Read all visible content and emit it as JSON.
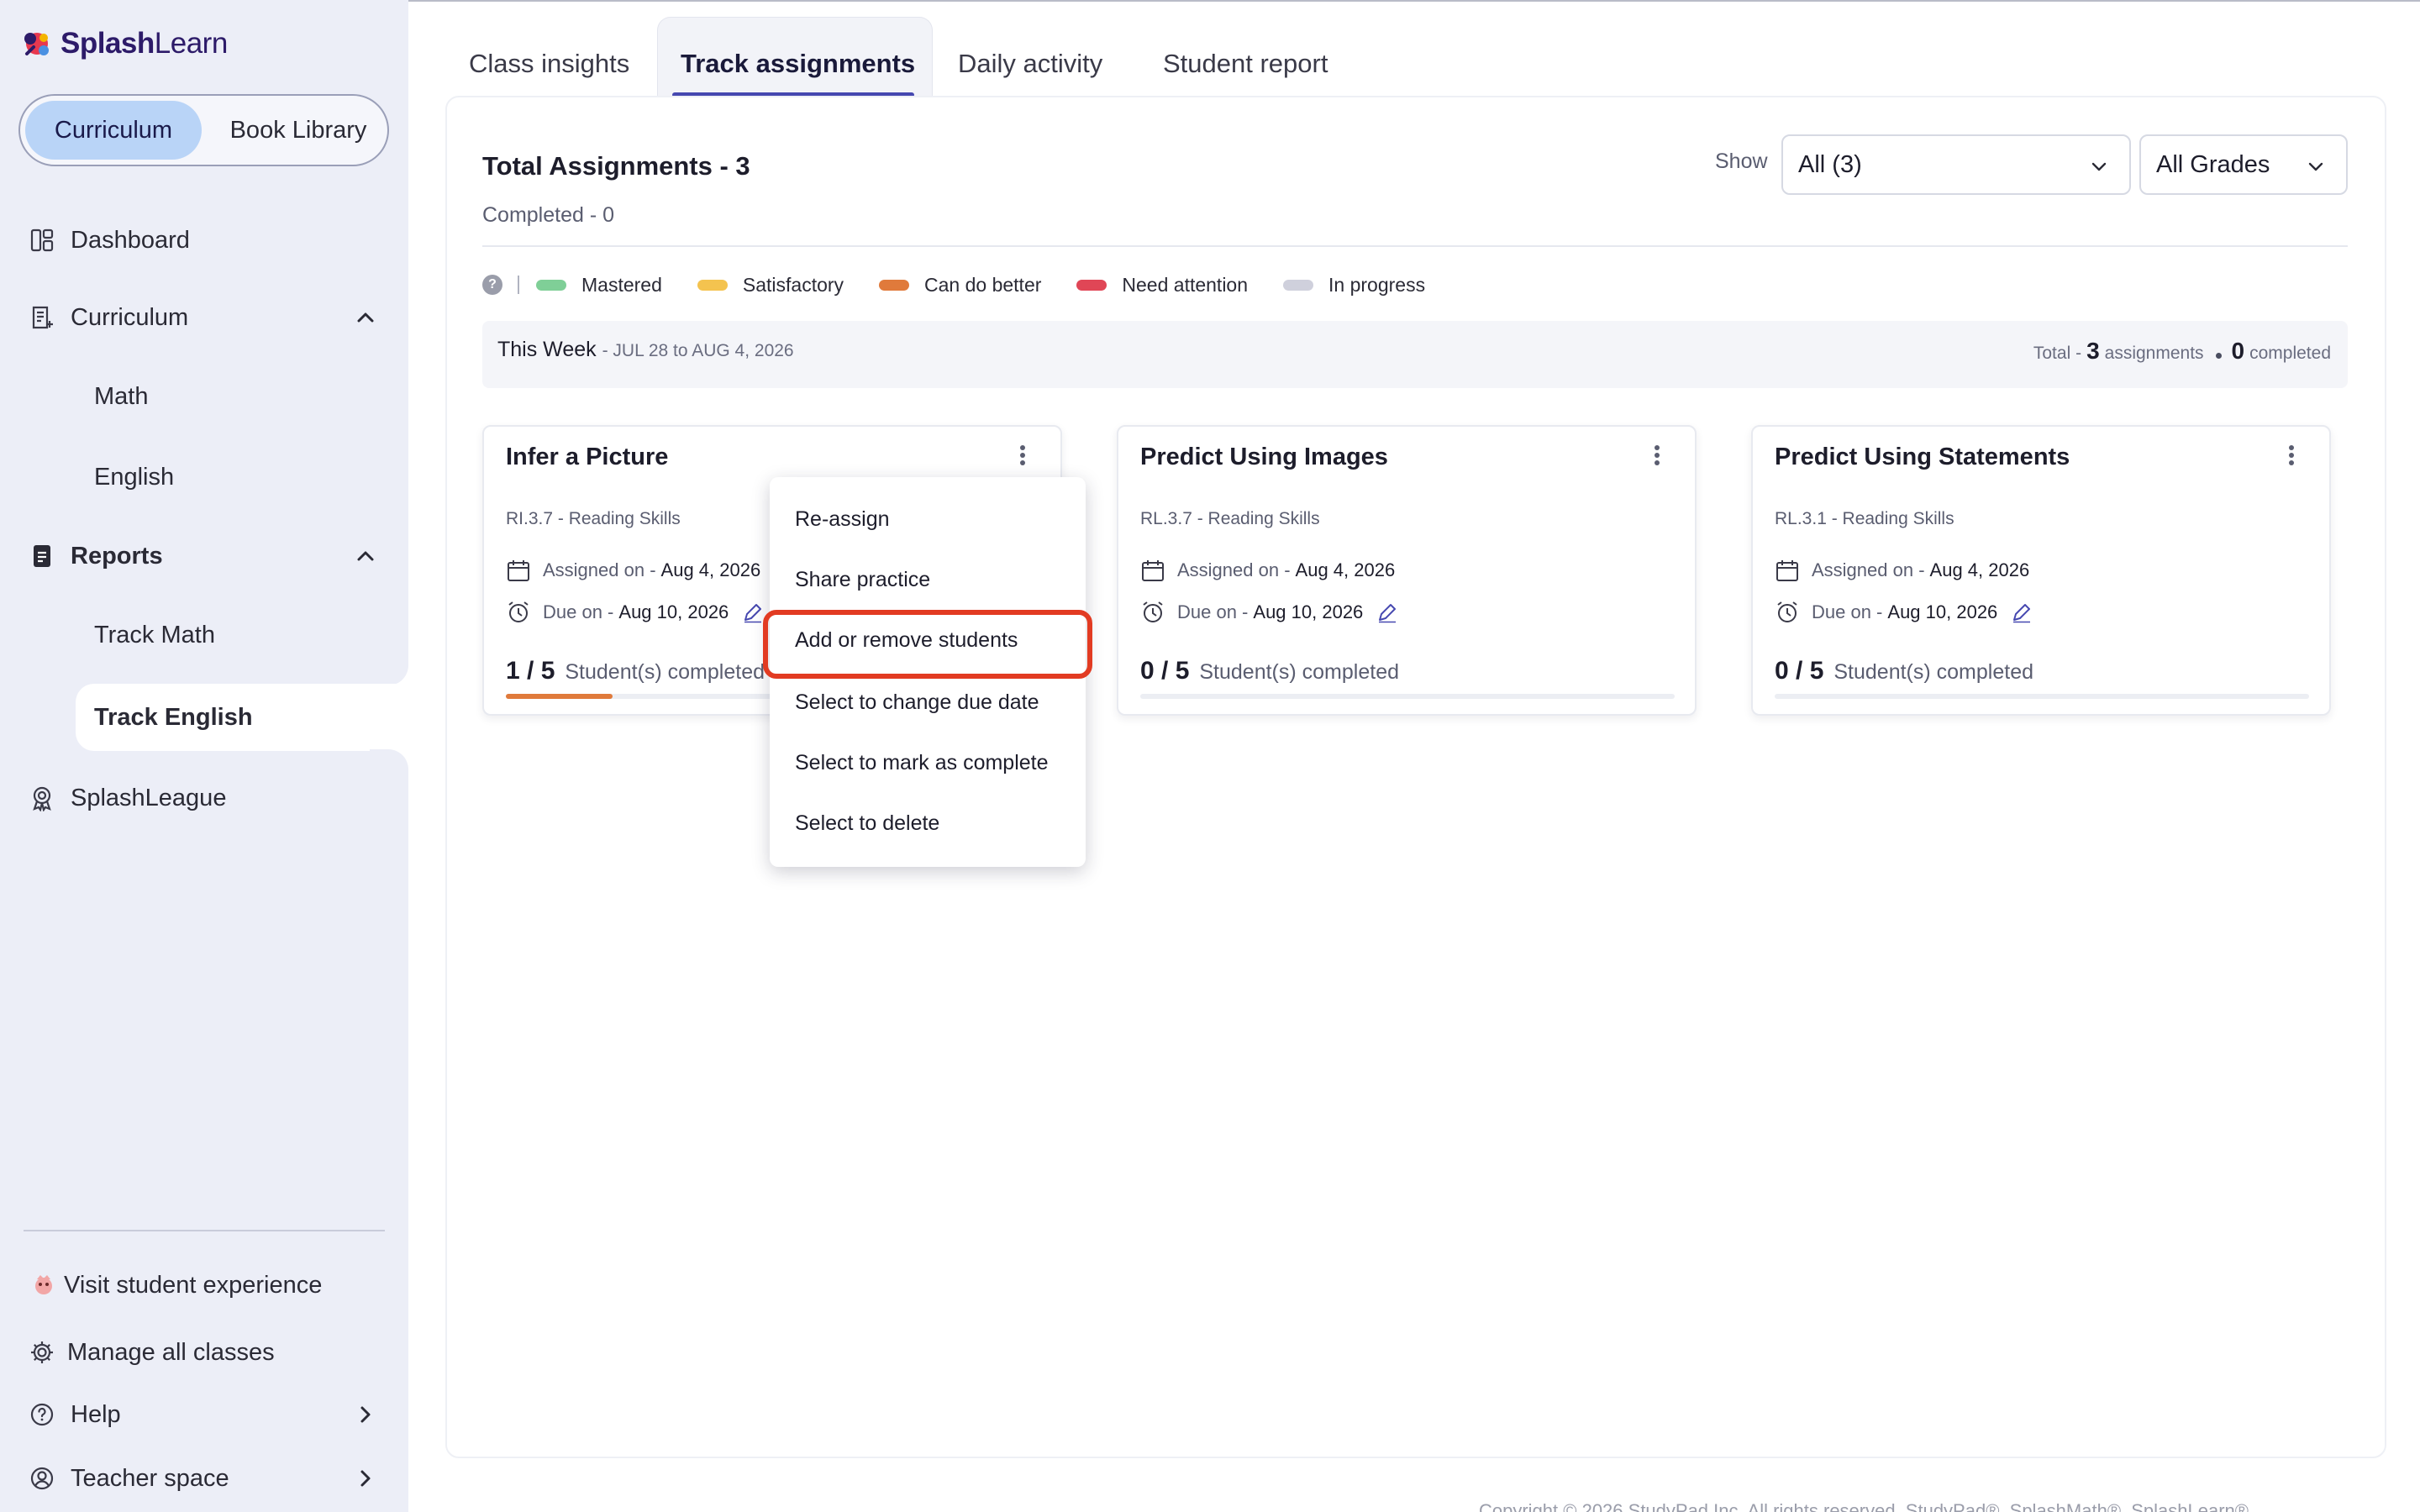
{
  "brand": {
    "name_bold": "Splash",
    "name_light": "Learn"
  },
  "segment": {
    "active": "Curriculum",
    "inactive": "Book Library"
  },
  "sidebar": {
    "dashboard": "Dashboard",
    "curriculum": "Curriculum",
    "curriculum_items": [
      "Math",
      "English"
    ],
    "reports": "Reports",
    "reports_items": [
      "Track Math",
      "Track English"
    ],
    "splashleague": "SplashLeague",
    "visit_student": "Visit student experience",
    "manage_classes": "Manage all classes",
    "help": "Help",
    "teacher_space": "Teacher space"
  },
  "tabs": [
    "Class insights",
    "Track assignments",
    "Daily activity",
    "Student report"
  ],
  "summary": {
    "title": "Total Assignments - 3",
    "completed": "Completed - 0",
    "show_label": "Show",
    "filter_value": "All (3)",
    "grade_value": "All Grades"
  },
  "legend": [
    {
      "label": "Mastered",
      "color": "#7fcf97"
    },
    {
      "label": "Satisfactory",
      "color": "#f4c34f"
    },
    {
      "label": "Can do better",
      "color": "#e07a3b"
    },
    {
      "label": "Need attention",
      "color": "#e04656"
    },
    {
      "label": "In progress",
      "color": "#cfd0dc"
    }
  ],
  "week": {
    "label": "This Week",
    "range": "- JUL 28 to AUG 4, 2026",
    "total_prefix": "Total -",
    "total_count": "3",
    "total_suffix": "assignments",
    "completed_count": "0",
    "completed_suffix": "completed"
  },
  "cards": [
    {
      "title": "Infer a Picture",
      "standard": "RI.3.7 - Reading Skills",
      "assigned_label": "Assigned on -",
      "assigned_date": "Aug 4, 2026",
      "due_label": "Due on -",
      "due_date": "Aug 10, 2026",
      "progress": "1 / 5",
      "progress_label": "Student(s) completed",
      "progress_fraction": 0.2
    },
    {
      "title": "Predict Using Images",
      "standard": "RL.3.7 - Reading Skills",
      "assigned_label": "Assigned on -",
      "assigned_date": "Aug 4, 2026",
      "due_label": "Due on -",
      "due_date": "Aug 10, 2026",
      "progress": "0 / 5",
      "progress_label": "Student(s) completed",
      "progress_fraction": 0
    },
    {
      "title": "Predict Using Statements",
      "standard": "RL.3.1 - Reading Skills",
      "assigned_label": "Assigned on -",
      "assigned_date": "Aug 4, 2026",
      "due_label": "Due on -",
      "due_date": "Aug 10, 2026",
      "progress": "0 / 5",
      "progress_label": "Student(s) completed",
      "progress_fraction": 0
    }
  ],
  "menu": {
    "items": [
      "Re-assign",
      "Share practice",
      "Add or remove students",
      "Select to change due date",
      "Select to mark as complete",
      "Select to delete"
    ],
    "highlighted": "Add or remove students"
  },
  "footer": {
    "text": "Copyright © 2026 StudyPad Inc. All rights reserved. StudyPad®, SplashMath®, SplashLearn®"
  },
  "colors": {
    "accent": "#4648b0",
    "highlight_border": "#e23b22",
    "sidebar_bg": "#eceef7"
  }
}
